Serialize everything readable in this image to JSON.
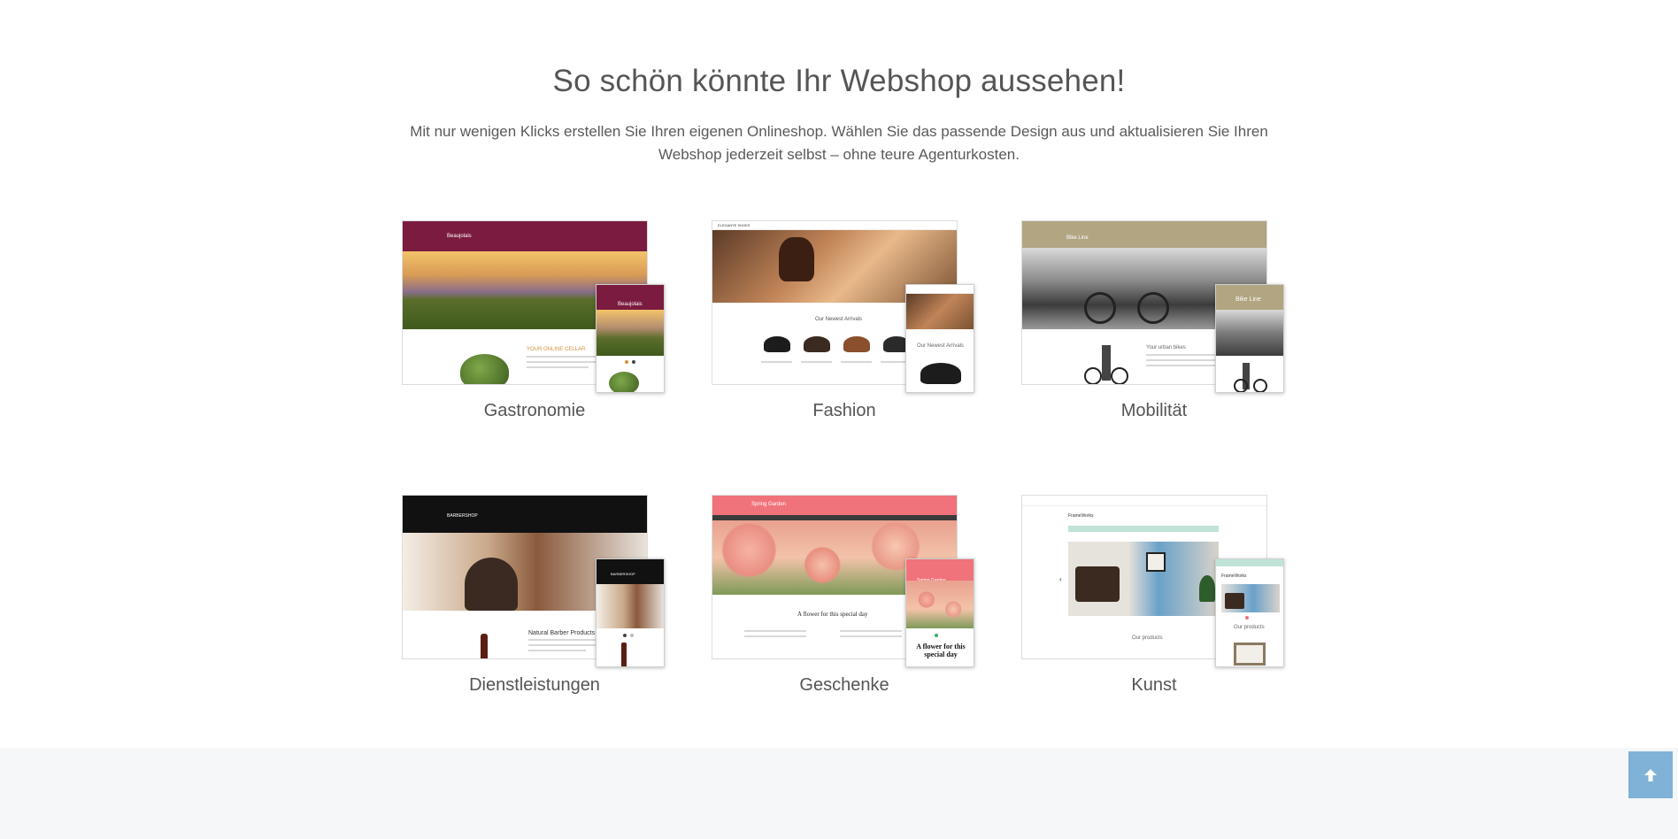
{
  "section": {
    "title": "So schön könnte Ihr Webshop aussehen!",
    "subtitle": "Mit nur wenigen Klicks erstellen Sie Ihren eigenen Onlineshop. Wählen Sie das passende Design aus und aktualisieren Sie Ihren Webshop jederzeit selbst – ohne teure Agenturkosten."
  },
  "templates": [
    {
      "label": "Gastronomie",
      "shop_name": "Beaujolais",
      "headline": "YOUR ONLINE CELLAR",
      "accent": "#7a1b3f"
    },
    {
      "label": "Fashion",
      "shop_name": "ELEGANTE SHOES",
      "headline": "Our Newest Arrivals",
      "accent": "#3a2a20"
    },
    {
      "label": "Mobilität",
      "shop_name": "Bike Line",
      "headline": "Your urban bikes",
      "accent": "#b1a582"
    },
    {
      "label": "Dienstleistungen",
      "shop_name": "BARBERSHOP",
      "headline": "Natural Barber Products",
      "accent": "#111111"
    },
    {
      "label": "Geschenke",
      "shop_name": "Spring Garden",
      "headline": "A flower for this special day",
      "accent": "#f0727a"
    },
    {
      "label": "Kunst",
      "shop_name": "FrameWorks",
      "headline": "Our products",
      "accent": "#bfe3d8"
    }
  ],
  "scroll_to_top": {
    "icon": "arrow-up-icon",
    "color": "#7fb2d6"
  }
}
